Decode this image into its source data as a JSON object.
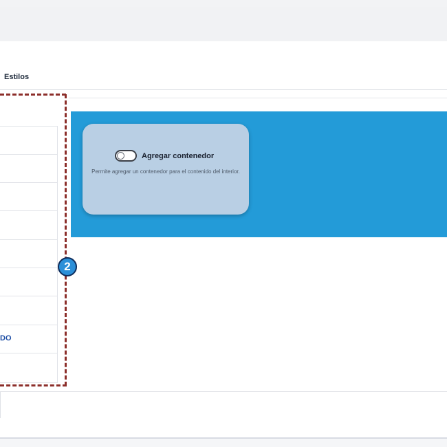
{
  "tabs": {
    "active_label": "Estilos"
  },
  "left_list": {
    "visible_fragment": "DO"
  },
  "callout": {
    "number": "2"
  },
  "card": {
    "toggle_label": "Agregar contenedor",
    "toggle_on": false,
    "description": "Permite agregar un contenedor para el contenido del interior."
  },
  "colors": {
    "band": "#239bd8",
    "card": "#b9cfe4",
    "callout_dash": "#8c2e2a",
    "badge": "#2b8fd8",
    "link": "#1f4fa6"
  }
}
